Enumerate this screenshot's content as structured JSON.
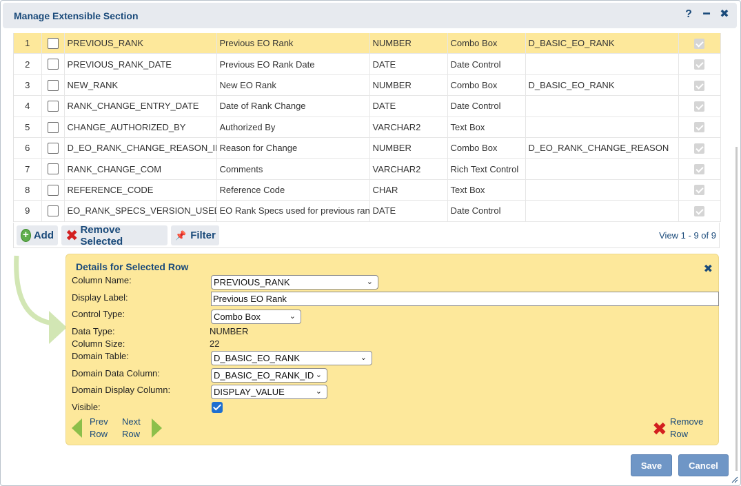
{
  "dialog": {
    "title": "Manage Extensible Section",
    "help_icon": "question-icon",
    "minimize_icon": "minimize-icon",
    "close_icon": "close-icon"
  },
  "grid": {
    "rows": [
      {
        "num": "1",
        "column": "PREVIOUS_RANK",
        "label": "Previous EO Rank",
        "type": "NUMBER",
        "control": "Combo Box",
        "domain": "D_BASIC_EO_RANK",
        "selected": true
      },
      {
        "num": "2",
        "column": "PREVIOUS_RANK_DATE",
        "label": "Previous EO Rank Date",
        "type": "DATE",
        "control": "Date Control",
        "domain": ""
      },
      {
        "num": "3",
        "column": "NEW_RANK",
        "label": "New EO Rank",
        "type": "NUMBER",
        "control": "Combo Box",
        "domain": "D_BASIC_EO_RANK"
      },
      {
        "num": "4",
        "column": "RANK_CHANGE_ENTRY_DATE",
        "label": "Date of Rank Change",
        "type": "DATE",
        "control": "Date Control",
        "domain": ""
      },
      {
        "num": "5",
        "column": "CHANGE_AUTHORIZED_BY",
        "label": "Authorized By",
        "type": "VARCHAR2",
        "control": "Text Box",
        "domain": ""
      },
      {
        "num": "6",
        "column": "D_EO_RANK_CHANGE_REASON_ID",
        "label": "Reason for Change",
        "type": "NUMBER",
        "control": "Combo Box",
        "domain": "D_EO_RANK_CHANGE_REASON"
      },
      {
        "num": "7",
        "column": "RANK_CHANGE_COM",
        "label": "Comments",
        "type": "VARCHAR2",
        "control": "Rich Text Control",
        "domain": ""
      },
      {
        "num": "8",
        "column": "REFERENCE_CODE",
        "label": "Reference Code",
        "type": "CHAR",
        "control": "Text Box",
        "domain": ""
      },
      {
        "num": "9",
        "column": "EO_RANK_SPECS_VERSION_USED",
        "label": "EO Rank Specs used for previous rank",
        "type": "DATE",
        "control": "Date Control",
        "domain": ""
      }
    ]
  },
  "toolbar": {
    "add_label": "Add",
    "remove_label": "Remove Selected",
    "filter_label": "Filter",
    "view_info": "View 1 - 9 of 9"
  },
  "details": {
    "title": "Details for Selected Row",
    "column_name_label": "Column Name:",
    "column_name_value": "PREVIOUS_RANK",
    "display_label_label": "Display Label:",
    "display_label_value": "Previous EO Rank",
    "control_type_label": "Control Type:",
    "control_type_value": "Combo Box",
    "data_type_label": "Data Type:",
    "data_type_value": "NUMBER",
    "column_size_label": "Column Size:",
    "column_size_value": "22",
    "domain_table_label": "Domain Table:",
    "domain_table_value": "D_BASIC_EO_RANK",
    "domain_data_column_label": "Domain Data Column:",
    "domain_data_column_value": "D_BASIC_EO_RANK_ID",
    "domain_display_column_label": "Domain Display Column:",
    "domain_display_column_value": "DISPLAY_VALUE",
    "visible_label": "Visible:",
    "visible_checked": true,
    "prev_label_1": "Prev",
    "prev_label_2": "Row",
    "next_label_1": "Next",
    "next_label_2": "Row",
    "remove_label_1": "Remove",
    "remove_label_2": "Row"
  },
  "footer": {
    "save_label": "Save",
    "cancel_label": "Cancel"
  },
  "colors": {
    "accent": "#1a4a7a",
    "selected_row": "#fde89b",
    "button_blue": "#6f96c6",
    "nav_green": "#8cbf4a",
    "remove_red": "#d31f1f"
  }
}
